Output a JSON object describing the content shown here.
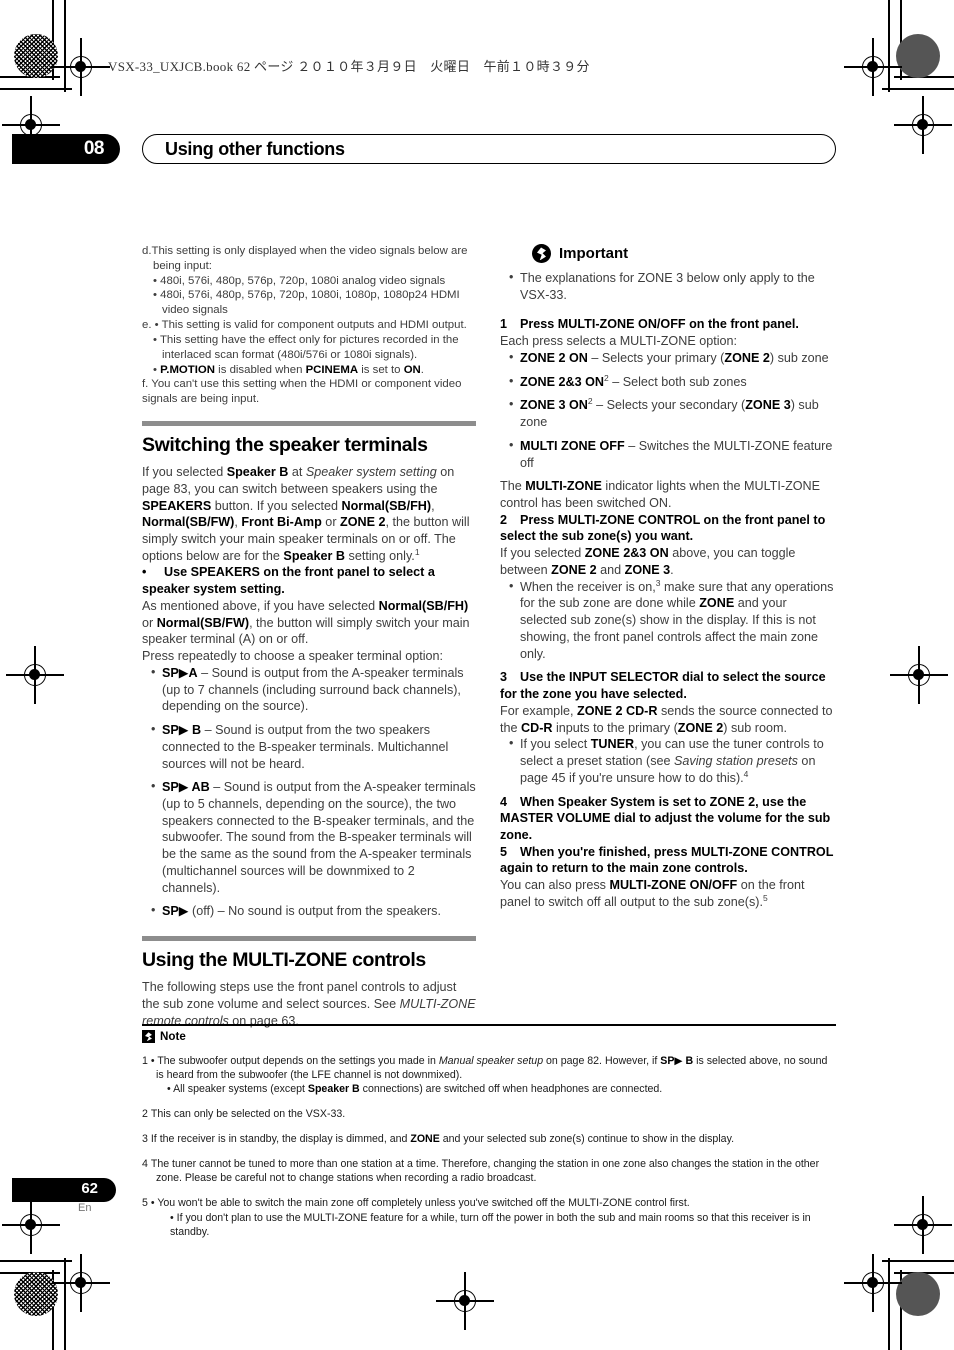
{
  "document": {
    "slug": "VSX-33_UXJCB.book  62 ページ  ２０１０年３月９日　火曜日　午前１０時３９分",
    "chapter_number": "08",
    "chapter_title": "Using other functions",
    "page_number": "62",
    "page_language": "En"
  },
  "left_column": {
    "footnote_block": {
      "d_line1": "d.This setting is only displayed when the video signals below are",
      "d_line2": "being input:",
      "d_bullet1": "480i, 576i, 480p, 576p, 720p, 1080i analog video signals",
      "d_bullet2": "480i, 576i, 480p, 576p, 720p, 1080i, 1080p, 1080p24 HDMI video signals",
      "e_label": "e.",
      "e_bullet1": "This setting is valid for component outputs and HDMI output.",
      "e_bullet2": "This setting have the effect only for pictures recorded in the interlaced scan format (480i/576i or 1080i signals).",
      "e_bullet3_pre": "",
      "e_bullet3_b1": "P.MOTION",
      "e_bullet3_mid": " is disabled when ",
      "e_bullet3_b2": "PCINEMA",
      "e_bullet3_mid2": " is set to ",
      "e_bullet3_b3": "ON",
      "e_bullet3_end": ".",
      "f_text": "f. You can't use this setting when the HDMI or component video signals are  being input."
    },
    "section1": {
      "heading": "Switching the speaker terminals",
      "intro_p1": "If you selected ",
      "intro_b1": "Speaker B",
      "intro_p2": " at ",
      "intro_i1": "Speaker system setting",
      "intro_p3": " on page 83, you can switch between speakers using the ",
      "intro_b2": "SPEAKERS",
      "intro_p4": " button. If you selected ",
      "intro_b3": "Normal(SB/FH)",
      "intro_p5": ", ",
      "intro_b4": "Normal(SB/FW)",
      "intro_p6": ", ",
      "intro_b5": "Front Bi-Amp",
      "intro_p7": " or ",
      "intro_b6": "ZONE 2",
      "intro_p8": ", the button will simply switch your main speaker terminals on or off. The options below are for the ",
      "intro_b7": "Speaker B",
      "intro_p9": " setting only.",
      "intro_sup": "1",
      "bullet_head": "Use SPEAKERS on the front panel to select a speaker system setting.",
      "body_p1": "As mentioned above, if you have selected ",
      "body_b1": "Normal(SB/FH)",
      "body_p2": " or ",
      "body_b2": "Normal(SB/FW)",
      "body_p3": ", the button will simply switch your main speaker terminal (A) on or off.",
      "body_p4": "Press repeatedly to choose a speaker terminal option:",
      "options": [
        {
          "label": "SP▶A",
          "text": " – Sound is output from the A-speaker terminals (up to 7 channels (including surround back channels), depending on the source)."
        },
        {
          "label": "SP▶ B",
          "text": " – Sound is output from the two speakers connected to the B-speaker terminals. Multichannel sources will not be heard."
        },
        {
          "label": "SP▶ AB",
          "text": " – Sound is output from the A-speaker terminals (up to 5 channels, depending on the source), the two speakers connected to the B-speaker terminals, and the subwoofer. The sound from the B-speaker terminals will be the same as the sound from the A-speaker terminals (multichannel sources will be downmixed to 2 channels)."
        },
        {
          "label": "SP▶",
          "text": " (off) – No sound is output from the speakers."
        }
      ]
    },
    "section2": {
      "heading": "Using the MULTI-ZONE controls",
      "body_p1": "The following steps use the front panel controls to adjust the sub zone volume and select sources. See ",
      "body_i1": "MULTI-ZONE remote controls",
      "body_p2": " on page 63."
    }
  },
  "right_column": {
    "important": {
      "title": "Important",
      "bullet": "The explanations for ZONE 3 below only apply to the VSX-33."
    },
    "steps": [
      {
        "num": "1",
        "title": "Press MULTI-ZONE ON/OFF on the front panel.",
        "body": "Each press selects a MULTI-ZONE option:"
      },
      {
        "num": "2",
        "title": "Press MULTI-ZONE CONTROL on the front panel to select the sub zone(s) you want.",
        "body_p1": "If you selected ",
        "body_b1": "ZONE 2&3 ON",
        "body_p2": " above, you can toggle between ",
        "body_b2": "ZONE 2",
        "body_p3": " and ",
        "body_b3": "ZONE 3",
        "body_p4": ".",
        "sub_bullet_p1": "When the receiver is on,",
        "sub_bullet_sup": "3",
        "sub_bullet_p2": " make sure that any operations for the sub zone are done while ",
        "sub_bullet_b1": "ZONE",
        "sub_bullet_p3": " and your selected sub zone(s) show in the display. If this is not showing, the front panel controls affect the main zone only."
      },
      {
        "num": "3",
        "title": "Use the INPUT SELECTOR dial to select the source for the zone you have selected.",
        "body_p1": "For example, ",
        "body_b1": "ZONE 2 CD-R",
        "body_p2": " sends the source connected to the ",
        "body_b2": "CD-R",
        "body_p3": " inputs to the primary (",
        "body_b3": "ZONE 2",
        "body_p4": ") sub room.",
        "sub_bullet_p1": "If you select ",
        "sub_bullet_b1": "TUNER",
        "sub_bullet_p2": ", you can use the tuner controls to select a preset station (see ",
        "sub_bullet_i1": "Saving station presets",
        "sub_bullet_p3": " on page 45 if you're unsure how to do this).",
        "sub_bullet_sup": "4"
      },
      {
        "num": "4",
        "title": "When Speaker System is set to ZONE 2, use the MASTER VOLUME dial to adjust the volume for the sub zone."
      },
      {
        "num": "5",
        "title": "When you're finished, press MULTI-ZONE CONTROL again to return to the main zone controls.",
        "body_p1": "You can also press ",
        "body_b1": "MULTI-ZONE ON/OFF",
        "body_p2": " on the front panel to switch off all output to the sub zone(s).",
        "body_sup": "5"
      }
    ],
    "zone_options": [
      {
        "label": "ZONE 2 ON",
        "sup": "",
        "text_pre": " – Selects your primary (",
        "bold_mid": "ZONE 2",
        "text_post": ") sub zone"
      },
      {
        "label": "ZONE 2&3 ON",
        "sup": "2",
        "text_pre": " – Select both sub zones",
        "bold_mid": "",
        "text_post": ""
      },
      {
        "label": "ZONE 3 ON",
        "sup": "2",
        "text_pre": " – Selects your secondary (",
        "bold_mid": "ZONE 3",
        "text_post": ") sub zone"
      },
      {
        "label": "MULTI ZONE OFF",
        "sup": "",
        "text_pre": " – Switches the MULTI-ZONE feature off",
        "bold_mid": "",
        "text_post": ""
      }
    ],
    "indicator_p1": "The ",
    "indicator_b1": "MULTI-ZONE",
    "indicator_p2": " indicator lights when the MULTI-ZONE control has been switched ON."
  },
  "notes": {
    "title": "Note",
    "items": [
      {
        "num": "1",
        "line1_p1": "• The subwoofer output depends on the settings you made in ",
        "line1_i1": "Manual speaker setup",
        "line1_p2": " on page 82. However, if ",
        "line1_b1": "SP▶ B",
        "line1_p3": " is selected above, no sound is heard from the subwoofer (the LFE channel is not downmixed).",
        "line2_p1": "• All speaker systems (except ",
        "line2_b1": "Speaker B",
        "line2_p2": " connections) are switched off when headphones are connected."
      },
      {
        "num": "2",
        "text": "This can only be selected on the VSX-33."
      },
      {
        "num": "3",
        "text_p1": "If the receiver is in standby, the display is dimmed, and ",
        "text_b1": "ZONE",
        "text_p2": " and your selected sub zone(s) continue to show in the display."
      },
      {
        "num": "4",
        "text": "The tuner cannot be tuned to more than one station at a time. Therefore, changing the station in one zone also changes the station in the other zone. Please be careful not to change stations when recording a radio broadcast."
      },
      {
        "num": "5",
        "line1": "• You won't be able to switch the main zone off completely unless you've switched off the MULTI-ZONE control first.",
        "line2": "• If you don't plan to use the MULTI-ZONE feature for a while, turn off the power in both the sub and main rooms so that this receiver is in standby."
      }
    ]
  }
}
